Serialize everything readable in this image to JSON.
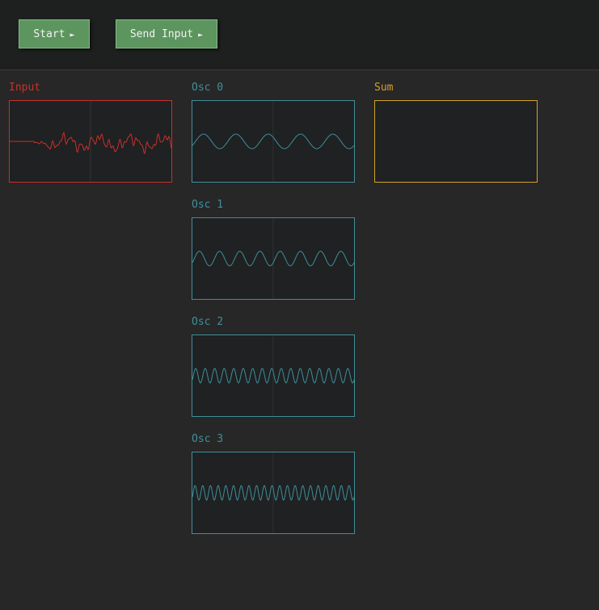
{
  "toolbar": {
    "start_label": "Start",
    "send_input_label": "Send Input",
    "arrow_glyph": "►"
  },
  "colors": {
    "input": "#c9302c",
    "oscillator": "#3f8f9a",
    "sum": "#d4a12a",
    "button": "#5d955f",
    "background": "#272727",
    "toolbar_bg": "#1e2020"
  },
  "panels": {
    "input": {
      "label": "Input"
    },
    "sum": {
      "label": "Sum"
    },
    "oscillators": [
      {
        "label": "Osc 0",
        "cycles": 5
      },
      {
        "label": "Osc 1",
        "cycles": 8
      },
      {
        "label": "Osc 2",
        "cycles": 17
      },
      {
        "label": "Osc 3",
        "cycles": 21
      }
    ]
  }
}
